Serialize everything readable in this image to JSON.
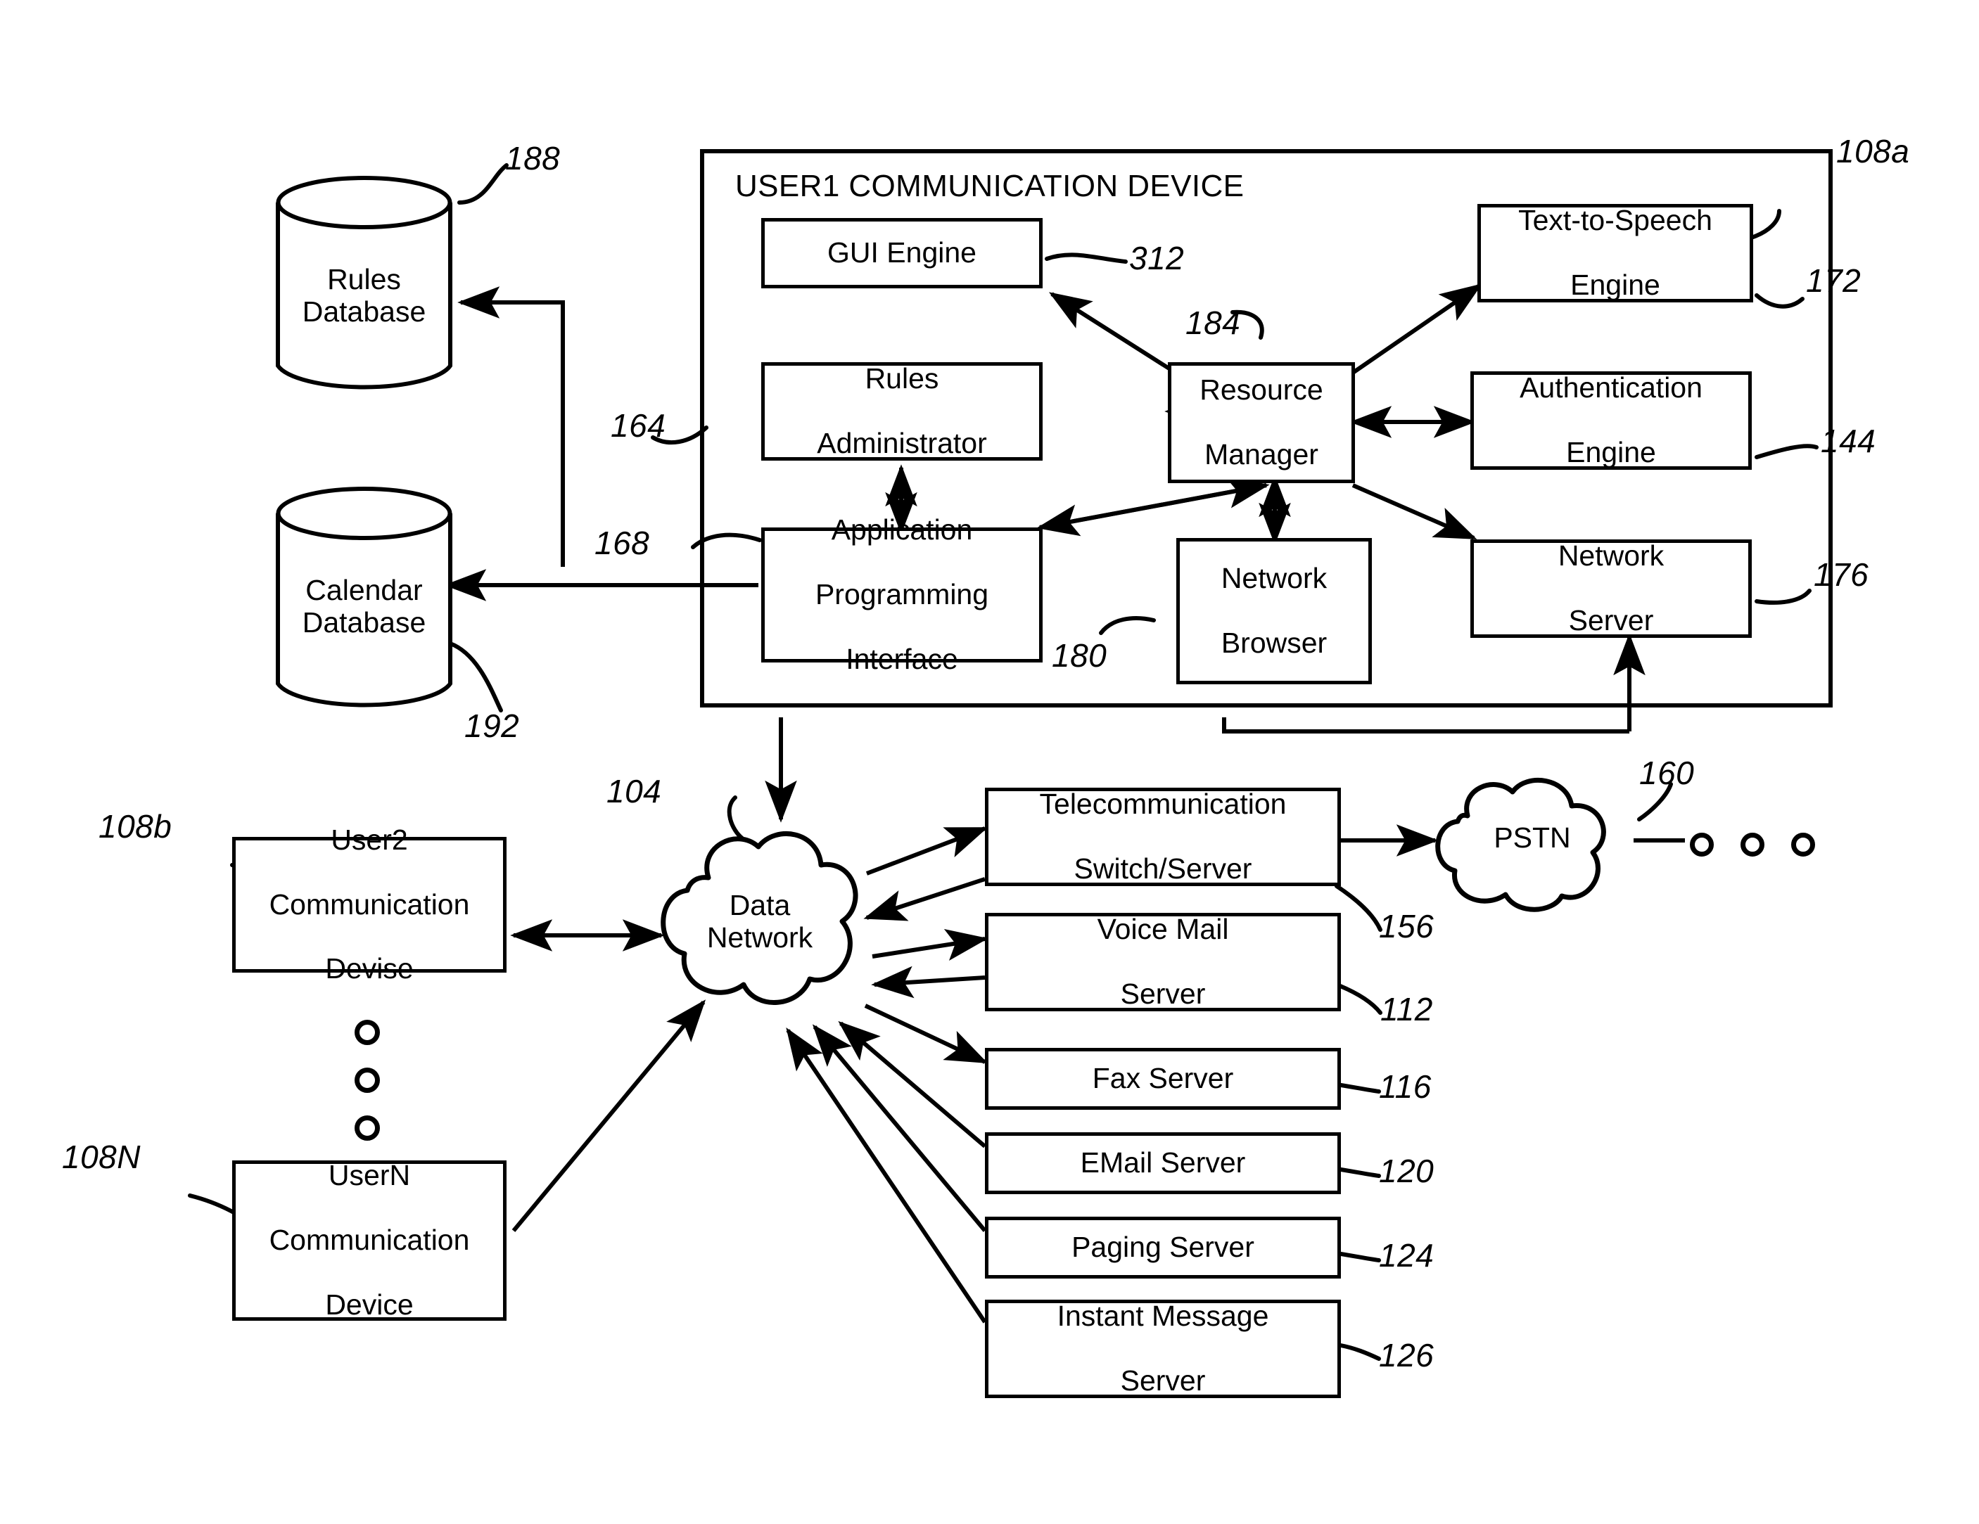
{
  "figure": {
    "type": "patent-block-diagram",
    "device_panel": {
      "title": "USER1 COMMUNICATION DEVICE",
      "ref": "108a",
      "blocks": [
        {
          "label": "GUI Engine",
          "ref": "312"
        },
        {
          "label": "Text-to-Speech\nEngine",
          "line1": "Text-to-Speech",
          "line2": "Engine",
          "ref": "172"
        },
        {
          "label": "Rules Administrator",
          "line1": "Rules",
          "line2": "Administrator",
          "ref": "164"
        },
        {
          "label": "Resource Manager",
          "line1": "Resource",
          "line2": "Manager",
          "ref": "184"
        },
        {
          "label": "Authentication Engine",
          "line1": "Authentication",
          "line2": "Engine",
          "ref": "144"
        },
        {
          "label": "Application Programming Interface",
          "line1": "Application",
          "line2": "Programming",
          "line3": "Interface",
          "ref": "168"
        },
        {
          "label": "Network Browser",
          "line1": "Network",
          "line2": "Browser",
          "ref": "180"
        },
        {
          "label": "Network Server",
          "line1": "Network",
          "line2": "Server",
          "ref": "176"
        }
      ]
    },
    "databases": [
      {
        "line1": "Rules",
        "line2": "Database",
        "ref": "188"
      },
      {
        "line1": "Calendar",
        "line2": "Database",
        "ref": "192"
      }
    ],
    "clouds": [
      {
        "line1": "Data",
        "line2": "Network",
        "ref": "104"
      },
      {
        "line1": "PSTN",
        "line2": "",
        "ref": "160"
      }
    ],
    "user_devices": [
      {
        "line1": "User2",
        "line2": "Communication",
        "line3": "Devise",
        "ref": "108b"
      },
      {
        "line1": "UserN",
        "line2": "Communication",
        "line3": "Device",
        "ref": "108N"
      }
    ],
    "servers": [
      {
        "line1": "Telecommunication",
        "line2": "Switch/Server",
        "ref": "156"
      },
      {
        "line1": "Voice Mail",
        "line2": "Server",
        "ref": "112"
      },
      {
        "line1": "Fax Server",
        "line2": "",
        "ref": "116"
      },
      {
        "line1": "EMail Server",
        "line2": "",
        "ref": "120"
      },
      {
        "line1": "Paging Server",
        "line2": "",
        "ref": "124"
      },
      {
        "line1": "Instant Message",
        "line2": "Server",
        "ref": "126"
      }
    ],
    "colors": {
      "ink": "#000000",
      "paper": "#ffffff"
    }
  }
}
